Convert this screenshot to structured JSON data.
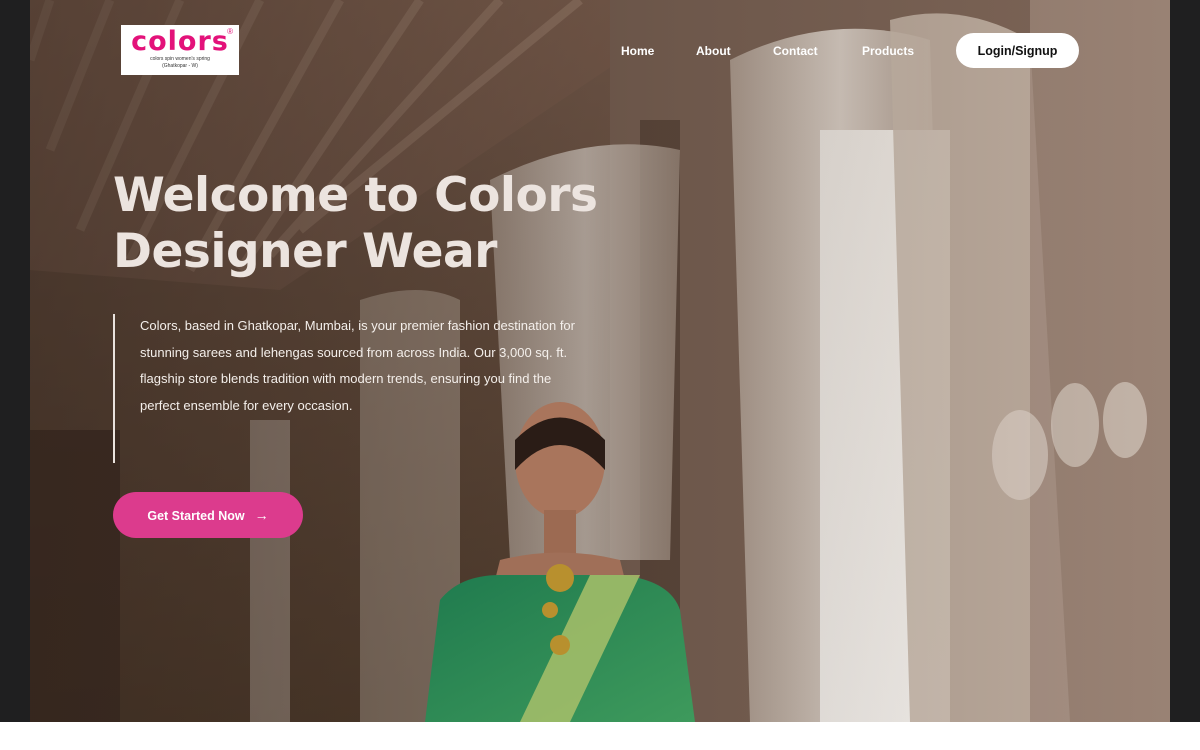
{
  "logo": {
    "wordmark": "colors",
    "registered": "®",
    "tagline": "colors spin women's spring",
    "location": "(Ghatkopar - W)"
  },
  "nav": {
    "items": [
      {
        "label": "Home"
      },
      {
        "label": "About"
      },
      {
        "label": "Contact"
      },
      {
        "label": "Products"
      }
    ],
    "login_label": "Login/Signup"
  },
  "hero": {
    "headline": "Welcome to Colors Designer Wear",
    "description": "Colors, based in Ghatkopar, Mumbai, is your premier fashion destination for stunning sarees and lehengas sourced from across India. Our 3,000 sq. ft. flagship store blends tradition with modern trends, ensuring you find the perfect ensemble for every occasion.",
    "cta_label": "Get Started Now",
    "cta_icon": "arrow-right-icon"
  },
  "colors": {
    "brand_pink": "#e3127a",
    "cta_pink": "#dc3b8d",
    "frame_dark": "#1f1f20"
  }
}
